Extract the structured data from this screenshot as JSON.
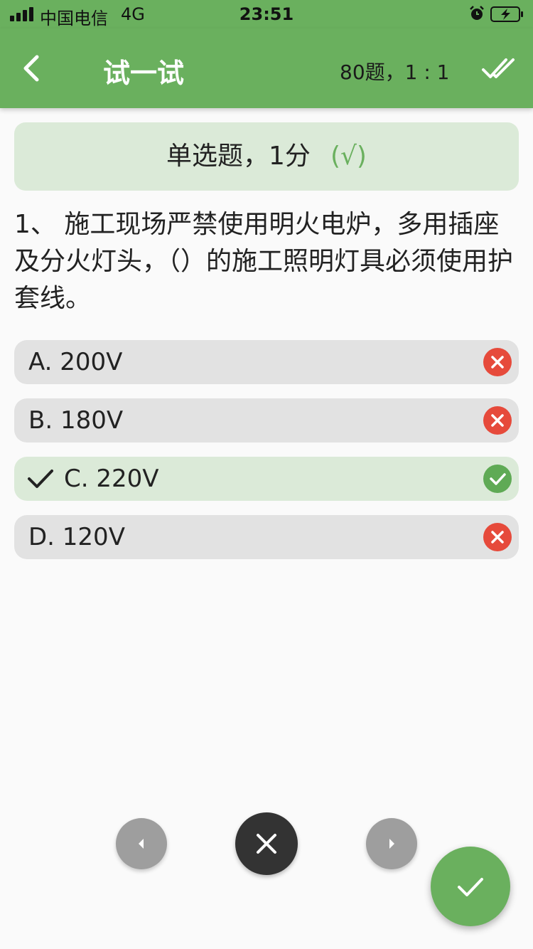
{
  "status_bar": {
    "carrier": "中国电信",
    "network": "4G",
    "time": "23:51"
  },
  "app_bar": {
    "title": "试一试",
    "progress": "80题，1 : 1"
  },
  "question": {
    "type_label": "单选题，1分",
    "result_mark": "(√)",
    "text": "1、 施工现场严禁使用明火电炉，多用插座及分火灯头，（）的施工照明灯具必须使用护套线。"
  },
  "options": [
    {
      "label": "A. 200V",
      "status": "wrong"
    },
    {
      "label": "B. 180V",
      "status": "wrong"
    },
    {
      "label": "C. 220V",
      "status": "correct",
      "selected": true
    },
    {
      "label": "D. 120V",
      "status": "wrong"
    }
  ],
  "colors": {
    "primary": "#6ab05e",
    "correct_bg": "#dbead8",
    "option_bg": "#e2e2e2",
    "wrong": "#e64a3b",
    "correct": "#5faa55"
  }
}
